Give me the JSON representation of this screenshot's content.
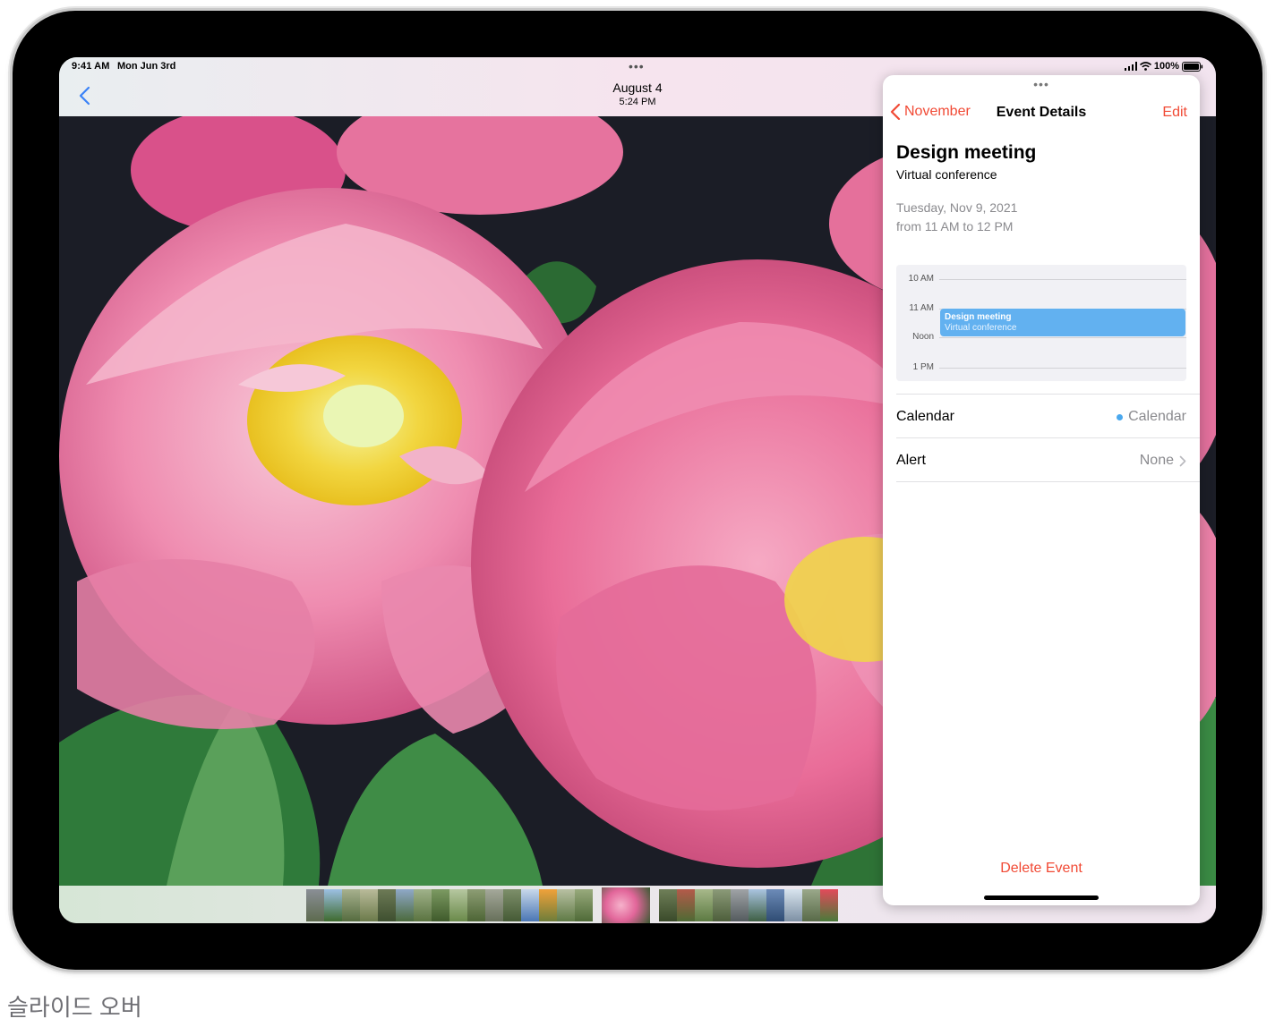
{
  "status_bar": {
    "time": "9:41 AM",
    "date": "Mon Jun 3rd",
    "battery": "100%"
  },
  "photos": {
    "title": "August 4",
    "subtitle": "5:24 PM",
    "multitask_dots": "•••"
  },
  "slide_over": {
    "multitask_dots": "•••",
    "back_label": "November",
    "nav_title": "Event Details",
    "edit_label": "Edit",
    "event": {
      "title": "Design meeting",
      "location": "Virtual conference",
      "date": "Tuesday, Nov 9, 2021",
      "time": "from 11 AM to 12 PM"
    },
    "day_view": {
      "hours": [
        "10 AM",
        "11 AM",
        "Noon",
        "1 PM"
      ],
      "block_title": "Design meeting",
      "block_subtitle": "Virtual conference"
    },
    "rows": {
      "calendar_label": "Calendar",
      "calendar_value": "Calendar",
      "alert_label": "Alert",
      "alert_value": "None"
    },
    "delete_label": "Delete Event"
  },
  "colors": {
    "accent_red": "#f14a35",
    "event_blue": "#62b1f0",
    "nav_blue": "#3a82f7"
  },
  "caption": "슬라이드 오버"
}
